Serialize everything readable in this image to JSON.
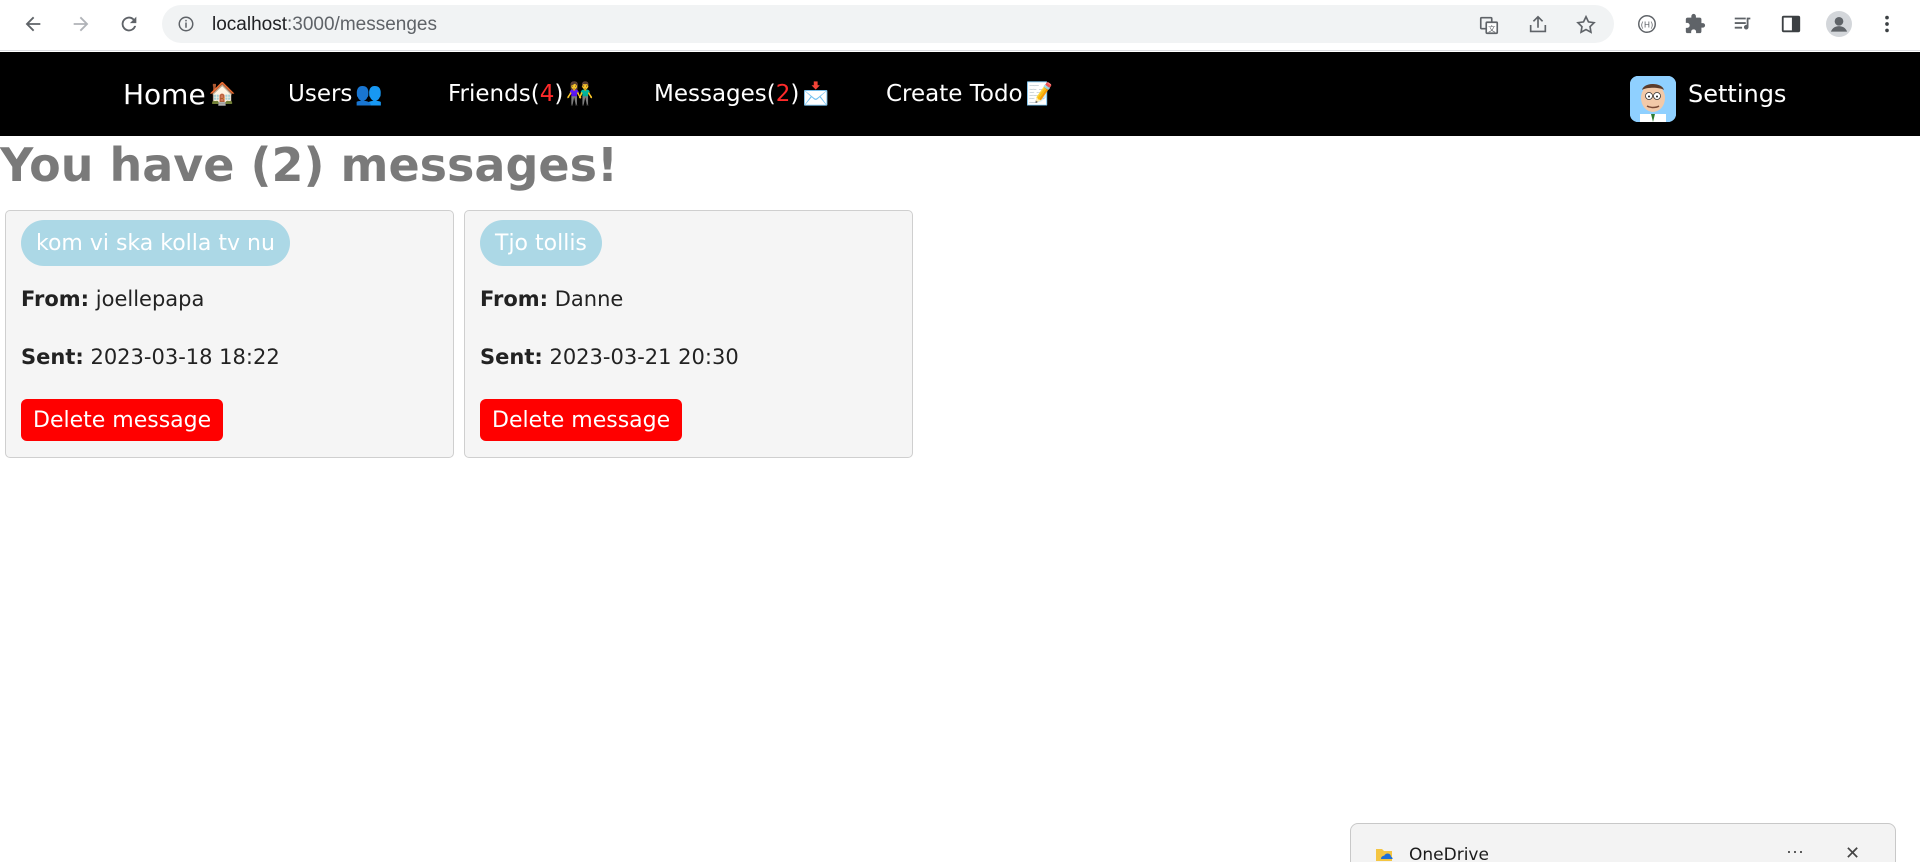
{
  "browser": {
    "url_host": "localhost",
    "url_rest": ":3000/messenges"
  },
  "nav": {
    "home": {
      "label": "Home",
      "emoji": "🏠"
    },
    "users": {
      "label": "Users",
      "emoji": "👥"
    },
    "friends": {
      "label": "Friends(",
      "count": "4",
      "close": ")",
      "emoji": "👫"
    },
    "messages": {
      "label": "Messages(",
      "count": "2",
      "close": ")",
      "emoji": "📩"
    },
    "create_todo": {
      "label": "Create Todo",
      "emoji": "📝"
    },
    "settings": "Settings"
  },
  "main": {
    "title": "You have (2) messages!",
    "from_label": "From:",
    "sent_label": "Sent:",
    "delete_label": "Delete message",
    "messages": [
      {
        "subject": "kom vi ska kolla tv nu",
        "from": "joellepapa",
        "sent": "2023-03-18 18:22"
      },
      {
        "subject": "Tjo tollis",
        "from": "Danne",
        "sent": "2023-03-21 20:30"
      }
    ]
  },
  "toast": {
    "title": "OneDrive",
    "more": "···",
    "close": "✕"
  },
  "colors": {
    "nav_bg": "#000000",
    "count": "#ff2a2a",
    "subject_pill": "#acd8e6",
    "delete": "#ff0000",
    "title": "#7a7a7a"
  }
}
